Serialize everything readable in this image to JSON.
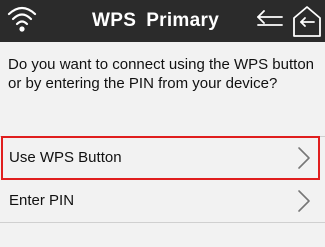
{
  "header": {
    "title_part1": "WPS",
    "title_part2": "Primary",
    "icons": {
      "status": "wifi-icon",
      "back": "back-arrow-icon",
      "home": "home-icon"
    },
    "background": "#2b2b2b"
  },
  "prompt": "Do you want to connect using the WPS button or by entering the PIN from your device?",
  "options": [
    {
      "label": "Use WPS Button",
      "icon": "chevron-right-icon",
      "selected": true
    },
    {
      "label": "Enter PIN",
      "icon": "chevron-right-icon",
      "selected": false
    }
  ],
  "colors": {
    "highlight": "#e01e1e",
    "background": "#f2f2f2"
  }
}
